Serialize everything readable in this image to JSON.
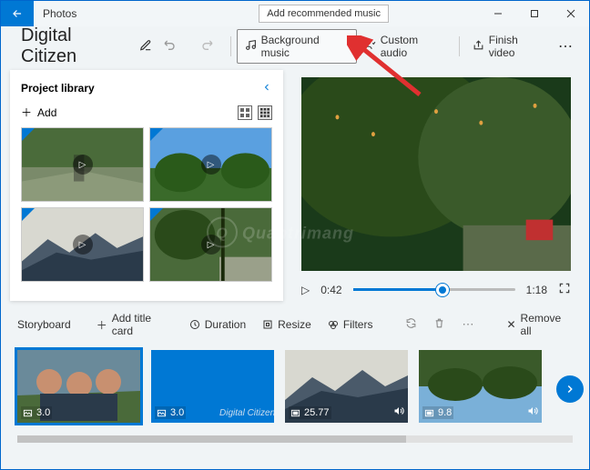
{
  "title_bar": {
    "app_name": "Photos",
    "tooltip": "Add recommended music"
  },
  "toolbar": {
    "project_name": "Digital Citizen",
    "background_music": "Background music",
    "custom_audio": "Custom audio",
    "finish_video": "Finish video"
  },
  "library": {
    "title": "Project library",
    "add_label": "Add"
  },
  "player": {
    "current": "0:42",
    "total": "1:18"
  },
  "storyboard": {
    "title": "Storyboard",
    "add_title_card": "Add title card",
    "duration": "Duration",
    "resize": "Resize",
    "filters": "Filters",
    "remove_all": "Remove all",
    "items": [
      {
        "duration": "3.0",
        "type": "image",
        "sound": false
      },
      {
        "duration": "3.0",
        "type": "image",
        "sound": false,
        "caption": "Digital Citizen"
      },
      {
        "duration": "25.77",
        "type": "video",
        "sound": true
      },
      {
        "duration": "9.8",
        "type": "video",
        "sound": true
      }
    ]
  },
  "annotation": {
    "watermark": "Quantrimang"
  }
}
